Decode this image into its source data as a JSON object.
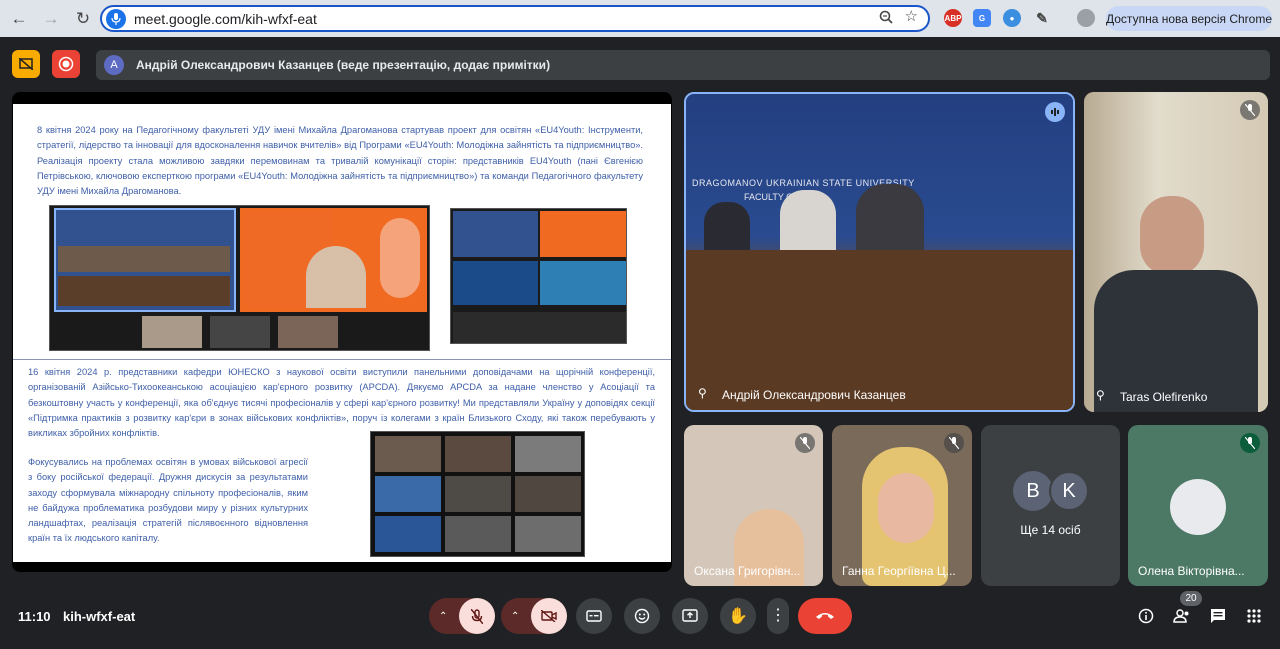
{
  "browser": {
    "url": "meet.google.com/kih-wfxf-eat",
    "update_label": "Доступна нова версія Chrome",
    "ext_abp": "ABP"
  },
  "meet": {
    "presenter_avatar": "A",
    "presenter_banner": "Андрій Олександрович Казанцев (веде презентацію, додає примітки)",
    "time": "11:10",
    "meeting_code": "kih-wfxf-eat",
    "participants_count": "20"
  },
  "slide": {
    "para1": "8 квітня 2024 року на Педагогічному факультеті УДУ імені Михайла Драгоманова стартував проект для освітян «EU4Youth: Інструменти, стратегії, лідерство та інновації для вдосконалення навичок вчителів» від Програми «EU4Youth: Молодіжна зайнятість та підприємництво». Реалізація проекту стала можливою завдяки перемовинам та тривалій комунікації сторін: представників EU4Youth (пані Євгенією Петрівською, ключовою експерткою програми «EU4Youth: Молодіжна зайнятість та підприємництво») та команди Педагогічного факультету УДУ імені Михайла Драгоманова.",
    "para2": "16 квітня 2024 р. представники кафедри ЮНЕСКО з наукової освіти виступили панельними доповідачами на щорічній конференції, організованій Азійсько-Тихоокеанською асоціацією кар'єрного розвитку (APCDA). Дякуємо APCDA за надане членство у Асоціації та безкоштовну участь у конференції, яка об'єднує тисячі професіоналів у сфері кар'єрного розвитку! Ми представляли Україну у доповідях секції «Підтримка практиків з розвитку кар'єри в зонах військових конфліктів», поруч із колегами з країн Близького Сходу, які також перебувають у викликах збройних конфліктів.",
    "para3": "Фокусувались на проблемах освітян в умовах військової агресії з боку російської федерації. Дружня дискусія за результатами заходу сформувала міжнародну спільноту професіоналів, яким не байдужа проблематика розбудови миру у різних культурних ландшафтах, реалізація стратегій післявоєнного відновлення країн та їх людського капіталу."
  },
  "tiles": {
    "main_name": "Андрій Олександрович Казанцев",
    "main_wall_text1": "DRAGOMANOV UKRAINIAN STATE UNIVERSITY",
    "main_wall_text2": "FACULTY OF PED",
    "taras_name": "Taras Olefirenko",
    "oksana_name": "Оксана Григорівн...",
    "ganna_name": "Ганна Георгіївна Ц...",
    "others_label": "Ще 14 осіб",
    "others_avatar1": "B",
    "others_avatar2": "K",
    "olena_name": "Олена Вікторівна..."
  },
  "colors": {
    "accent_blue": "#8ab4f8",
    "end_call_red": "#ea4335",
    "muted_pink": "#f9dedc"
  }
}
